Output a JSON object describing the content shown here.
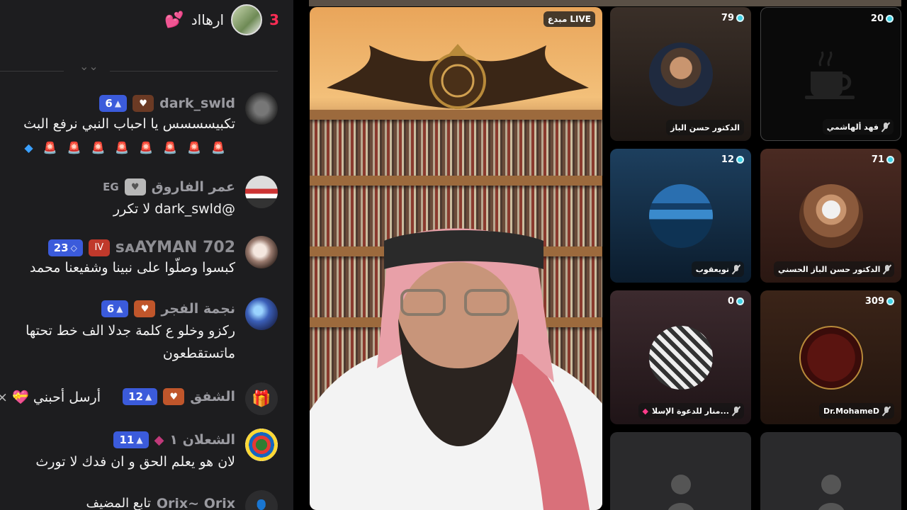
{
  "top_ranker": {
    "rank": "3",
    "name": "ارهااد",
    "heart": "💕"
  },
  "messages": [
    {
      "user": "dark_swld",
      "level": "6",
      "text1": "تكبيسسسس يا احباب النبي نرفع البث",
      "text2": ""
    },
    {
      "user": "عمر الفاروق",
      "suffix": "EG",
      "text1": "@dark_swld لا تكرر"
    },
    {
      "user": "sᴀAYMAN 702",
      "level": "23",
      "badge": "IV",
      "text1": "كبسوا وصلّوا على نبينا وشفيعنا محمد"
    },
    {
      "user": "نجمة الفجر",
      "level": "6",
      "text1": "ركزو وخلو ع كلمة جدلا الف خط تحتها",
      "text2": "ماتستقطعون"
    },
    {
      "user": "الشفق",
      "level": "12",
      "text1": "أرسل أحبني"
    },
    {
      "user": "الشعلان ١",
      "level": "11",
      "text1": "لان هو يعلم الحق و ان فدك لا تورث"
    },
    {
      "user": "Orix~ Orix",
      "text1": "تابع المضيف"
    }
  ],
  "stream": {
    "live_label": "LIVE",
    "host_label": "مبدع"
  },
  "guests": [
    {
      "count": "79",
      "name": "الدكتور حسن الباز"
    },
    {
      "count": "20",
      "name": "فهد ألهاشمي"
    },
    {
      "count": "12",
      "name": "نويعقوب"
    },
    {
      "count": "71",
      "name": "الدكتور حسن الباز الحسني"
    },
    {
      "count": "0",
      "name": "منار للدعوة الإسلا..."
    },
    {
      "count": "309",
      "name": "Dr.MohameD"
    }
  ]
}
